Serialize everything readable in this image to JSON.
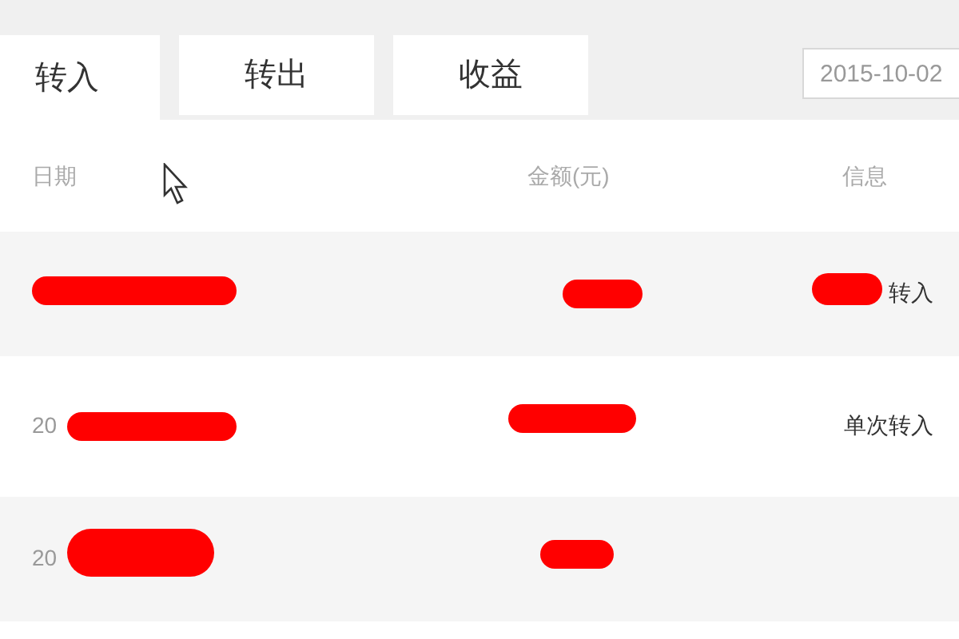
{
  "tabs": [
    {
      "label": "转入",
      "selected": true
    },
    {
      "label": "转出",
      "selected": false
    },
    {
      "label": "收益",
      "selected": false
    }
  ],
  "date_field": {
    "value": "2015-10-02"
  },
  "table": {
    "columns": [
      "日期",
      "金额(元)",
      "信息"
    ],
    "rows": [
      {
        "info": "转入"
      },
      {
        "date": "20",
        "info": "单次转入"
      },
      {
        "date": "20"
      }
    ]
  }
}
